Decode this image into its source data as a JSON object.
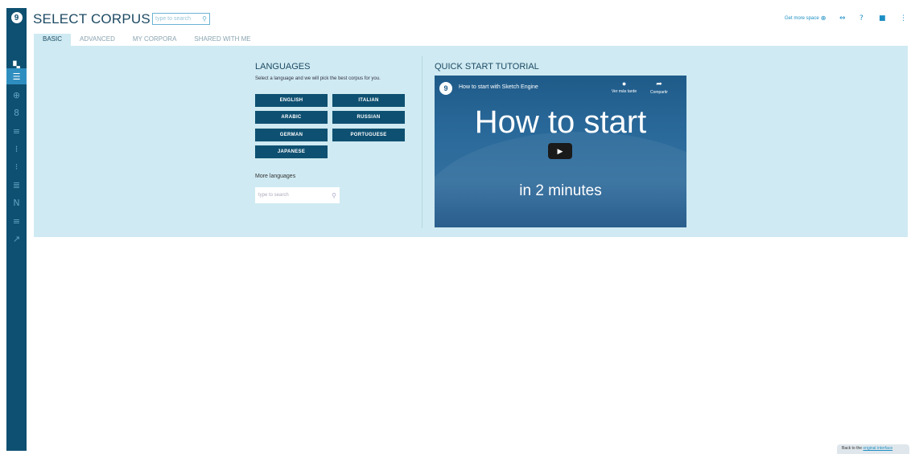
{
  "app": {
    "logo_glyph": "9",
    "page_title": "SELECT CORPUS"
  },
  "top_search": {
    "placeholder": "type to search"
  },
  "top_right": {
    "get_more_space_label": "Get more space"
  },
  "tabs": [
    {
      "label": "BASIC",
      "active": true
    },
    {
      "label": "ADVANCED",
      "active": false
    },
    {
      "label": "MY CORPORA",
      "active": false
    },
    {
      "label": "SHARED WITH ME",
      "active": false
    }
  ],
  "languages": {
    "title": "LANGUAGES",
    "subtitle": "Select a language and we will pick the best corpus for you.",
    "buttons": [
      "ENGLISH",
      "ITALIAN",
      "ARABIC",
      "RUSSIAN",
      "GERMAN",
      "PORTUGUESE",
      "JAPANESE"
    ],
    "more_label": "More languages",
    "search_placeholder": "type to search"
  },
  "quick_start": {
    "title": "QUICK START TUTORIAL",
    "video": {
      "logo_glyph": "9",
      "title": "How to start with Sketch Engine",
      "watch_later": "Ver más tarde",
      "share": "Compartir",
      "headline": "How to start",
      "subline": "in 2 minutes"
    }
  },
  "footer": {
    "back_prefix": "Back to the ",
    "back_link": "original interface"
  },
  "icons": {
    "sidebar": [
      "dashboard-icon",
      "corpus-list-icon",
      "concordance-icon",
      "wordsketch-icon",
      "thesaurus-icon",
      "sketch-diff-icon",
      "wordlist-icon",
      "keywords-icon",
      "ngrams-icon",
      "terms-icon",
      "trends-icon"
    ]
  },
  "colors": {
    "sidebar": "#0e5071",
    "panel": "#cfeaf2",
    "button": "#0e5071",
    "accent": "#1e8fc4"
  }
}
